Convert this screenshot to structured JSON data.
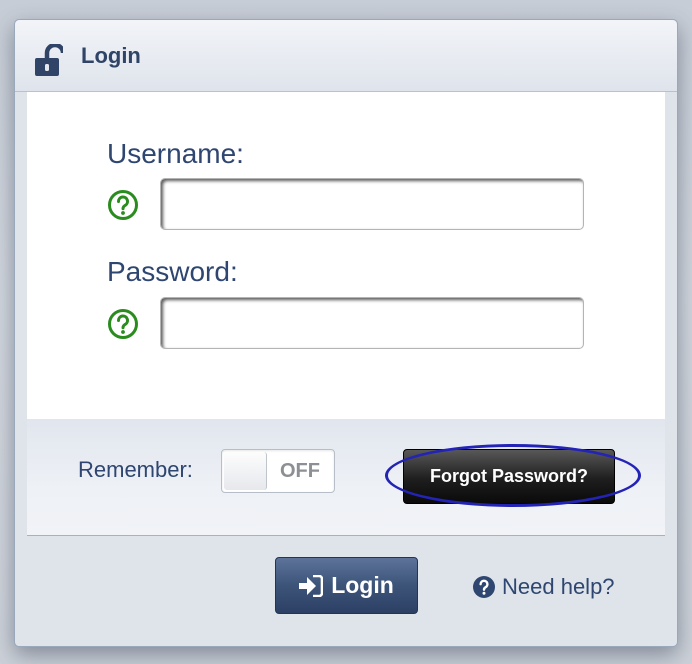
{
  "dialog": {
    "title": "Login"
  },
  "form": {
    "username_label": "Username:",
    "username_value": "",
    "password_label": "Password:",
    "password_value": ""
  },
  "options": {
    "remember_label": "Remember:",
    "remember_toggle_state": "OFF",
    "forgot_password_label": "Forgot Password?"
  },
  "footer": {
    "login_label": "Login",
    "need_help_label": "Need help?"
  },
  "colors": {
    "accent_blue": "#2e4670",
    "help_green": "#2a8c1e",
    "highlight_ring": "#2323b5"
  },
  "icons": [
    "unlock-icon",
    "help-circle-icon",
    "sign-in-icon",
    "question-circle-icon"
  ]
}
